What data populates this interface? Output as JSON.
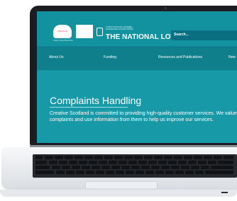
{
  "header": {
    "cs_logo_caption": "ALBA | CHRUTHACHAIL",
    "lottery_line1": "A TEXT SCHOOL SCHEME",
    "lottery_line2": "ADVANCING FUNDS FROM",
    "lottery_name": "THE NATIONAL LOTTERY",
    "search_label": "Search..."
  },
  "nav": {
    "items": [
      "About Us",
      "Funding",
      "Resources and Publications",
      "New"
    ]
  },
  "content": {
    "title": "Complaints Handling",
    "intro": "Creative Scotland is committed to providing high-quality customer services. We value complaints and use information from them to help us improve our services."
  },
  "colors": {
    "accent": "#1598a6",
    "nav": "#0f7f8b",
    "search": "#0a6f80"
  }
}
